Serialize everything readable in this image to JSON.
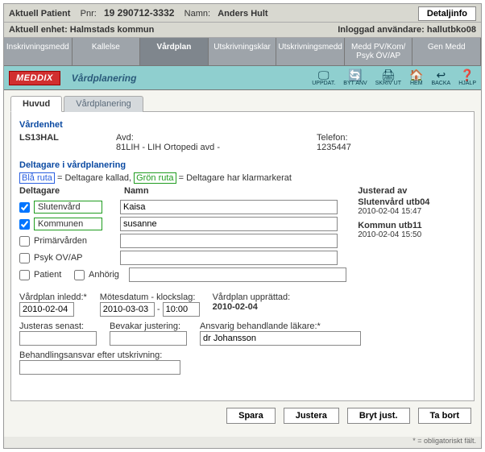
{
  "header": {
    "aktuell_patient": "Aktuell Patient",
    "pnr_label": "Pnr:",
    "pnr": "19 290712-3332",
    "namn_label": "Namn:",
    "namn": "Anders Hult",
    "detaljinfo": "Detaljinfo",
    "aktuell_enhet_label": "Aktuell enhet:",
    "aktuell_enhet": "Halmstads kommun",
    "inloggad_label": "Inloggad användare:",
    "inloggad_user": "hallutbko08"
  },
  "topnav": {
    "items": [
      "Inskrivningsmedd",
      "Kallelse",
      "Vårdplan",
      "Utskrivningsklar",
      "Utskrivningsmedd",
      "Medd PV/Kom/\nPsyk ÖV/AP",
      "Gen Medd"
    ],
    "activeIndex": 2
  },
  "subbar": {
    "brand": "MEDDIX",
    "title": "Vårdplanering",
    "icons": [
      {
        "id": "uppdat",
        "label": "UPPDAT.",
        "glyph": "🖵"
      },
      {
        "id": "bytanv",
        "label": "BYT ANV",
        "glyph": "🔄"
      },
      {
        "id": "skrivut",
        "label": "SKRIV UT",
        "glyph": "🖨"
      },
      {
        "id": "hem",
        "label": "HEM",
        "glyph": "🏠"
      },
      {
        "id": "backa",
        "label": "BACKA",
        "glyph": "↩"
      },
      {
        "id": "hjalp",
        "label": "HJÄLP",
        "glyph": "❓"
      }
    ]
  },
  "innerTabs": {
    "items": [
      "Huvud",
      "Vårdplanering"
    ],
    "activeIndex": 0
  },
  "panel": {
    "vardenhet_title": "Vårdenhet",
    "unit_code": "LS13HAL",
    "avd_label": "Avd:",
    "avd_value": "81LIH - LIH Ortopedi avd -",
    "telefon_label": "Telefon:",
    "telefon_value": "1235447",
    "deltagare_title": "Deltagare i vårdplanering",
    "legend": {
      "blue": "Blå ruta",
      "blue_txt": " = Deltagare kallad,  ",
      "green": "Grön ruta",
      "green_txt": " = Deltagare har klarmarkerat"
    },
    "col_deltagare": "Deltagare",
    "col_namn": "Namn",
    "justerad_av": "Justerad av",
    "participants": [
      {
        "label": "Slutenvård",
        "checked": true,
        "boxed": true,
        "name": "Kaisa"
      },
      {
        "label": "Kommunen",
        "checked": true,
        "boxed": true,
        "name": "susanne"
      },
      {
        "label": "Primärvården",
        "checked": false,
        "boxed": false,
        "name": ""
      },
      {
        "label": "Psyk OV/AP",
        "checked": false,
        "boxed": false,
        "name": ""
      }
    ],
    "patient_label": "Patient",
    "anhorig_label": "Anhörig",
    "justerad": [
      {
        "title": "Slutenvård utb04",
        "date": "2010-02-04 15:47"
      },
      {
        "title": "Kommun utb11",
        "date": "2010-02-04 15:50"
      }
    ],
    "vardplan_inledd_label": "Vårdplan inledd:*",
    "vardplan_inledd": "2010-02-04",
    "motes_label": "Mötesdatum - klockslag:",
    "motes_date": "2010-03-03",
    "motes_sep": "-",
    "motes_time": "10:00",
    "upprattad_label": "Vårdplan upprättad:",
    "upprattad": "2010-02-04",
    "justeras_senast_label": "Justeras senast:",
    "justeras_senast": "",
    "bevakar_label": "Bevakar justering:",
    "bevakar": "",
    "ansvarig_label": "Ansvarig behandlande läkare:*",
    "ansvarig": "dr Johansson",
    "behandling_label": "Behandlingsansvar efter utskrivning:",
    "behandling": "",
    "name_input_label": "Namn"
  },
  "footer": {
    "spara": "Spara",
    "justera": "Justera",
    "bryt": "Bryt just.",
    "tabort": "Ta bort"
  },
  "footnote": "* = obligatoriskt fält."
}
